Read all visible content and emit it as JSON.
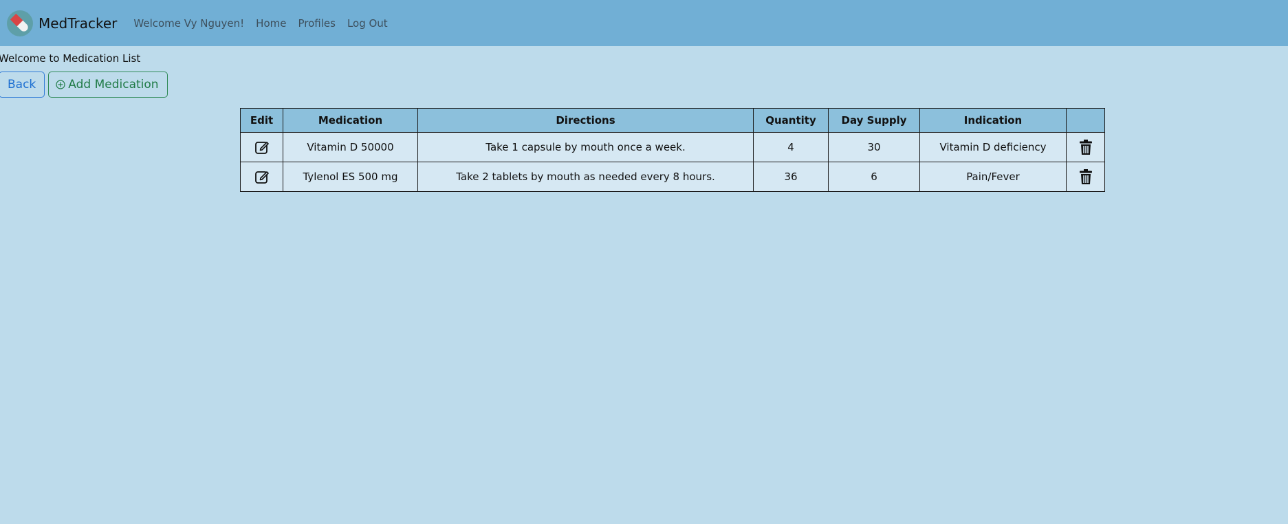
{
  "app": {
    "brand": "MedTracker",
    "logo_icon": "pill-capsule-icon"
  },
  "nav": {
    "welcome": "Welcome Vy Nguyen!",
    "links": [
      "Home",
      "Profiles",
      "Log Out"
    ]
  },
  "page": {
    "welcome_line": "Welcome to Medication List",
    "back_label": "Back",
    "add_label": "Add Medication",
    "add_icon": "plus-circle-icon"
  },
  "table": {
    "headers": [
      "Edit",
      "Medication",
      "Directions",
      "Quantity",
      "Day Supply",
      "Indication",
      ""
    ],
    "rows": [
      {
        "medication": "Vitamin D 50000",
        "directions": "Take 1 capsule by mouth once a week.",
        "quantity": "4",
        "day_supply": "30",
        "indication": "Vitamin D deficiency",
        "edit_icon": "edit-icon",
        "delete_icon": "trash-icon"
      },
      {
        "medication": "Tylenol ES 500 mg",
        "directions": "Take 2 tablets by mouth as needed every 8 hours.",
        "quantity": "36",
        "day_supply": "6",
        "indication": "Pain/Fever",
        "edit_icon": "edit-icon",
        "delete_icon": "trash-icon"
      }
    ]
  },
  "colors": {
    "navbar": "#71afd5",
    "background": "#bddbeb",
    "table_header": "#8cc0dc",
    "table_cell": "#d6e8f3",
    "back_button": "#1d6fd1",
    "add_button": "#1f7a46"
  }
}
